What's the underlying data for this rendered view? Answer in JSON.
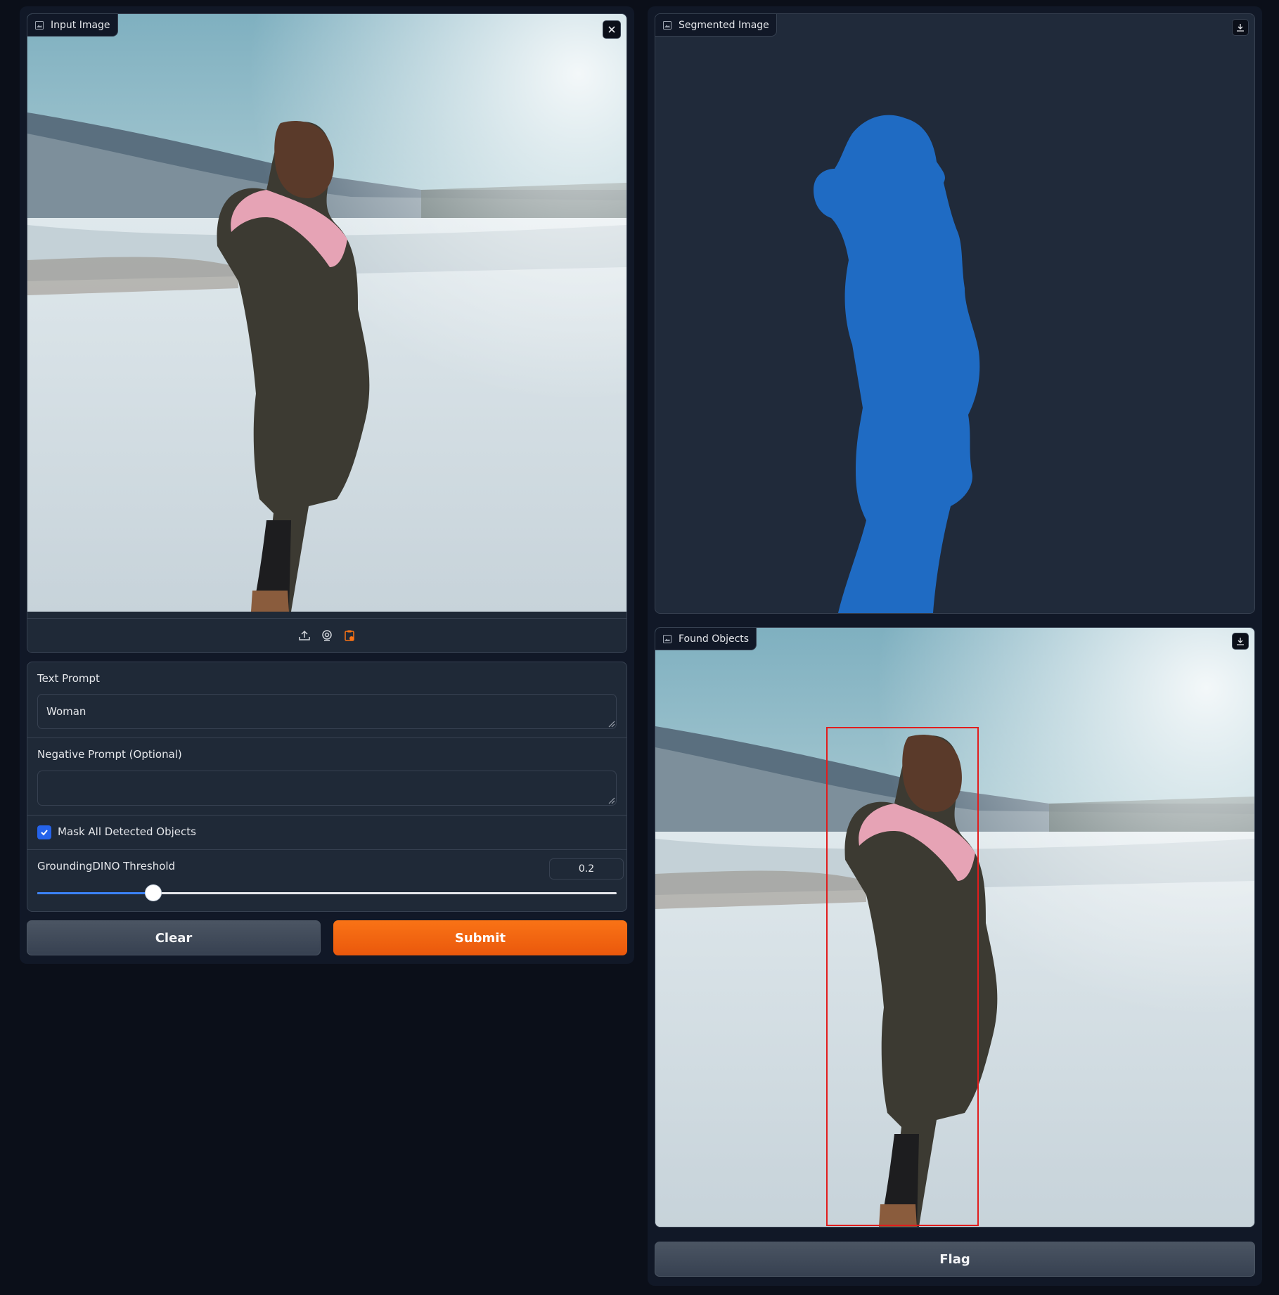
{
  "input_image": {
    "label": "Input Image",
    "icon": "image-icon",
    "clear_icon": "close-icon",
    "source_icons": [
      "upload-icon",
      "webcam-icon",
      "clipboard-icon"
    ]
  },
  "segmented_image": {
    "label": "Segmented Image",
    "icon": "image-icon",
    "download_icon": "download-icon",
    "mask_color": "#1f6bc3"
  },
  "found_objects": {
    "label": "Found Objects",
    "icon": "image-icon",
    "download_icon": "download-icon",
    "box_color": "#e11d1d"
  },
  "form": {
    "text_prompt": {
      "label": "Text Prompt",
      "value": "Woman"
    },
    "negative_prompt": {
      "label": "Negative Prompt (Optional)",
      "value": ""
    },
    "mask_all": {
      "label": "Mask All Detected Objects",
      "checked": true
    },
    "threshold": {
      "label": "GroundingDINO Threshold",
      "value": "0.2",
      "fill_fraction": 0.2
    }
  },
  "buttons": {
    "clear": "Clear",
    "submit": "Submit",
    "flag": "Flag"
  },
  "colors": {
    "background": "#0b0f19",
    "panel": "#111827",
    "primary": "#f97316",
    "accent": "#2563eb"
  }
}
